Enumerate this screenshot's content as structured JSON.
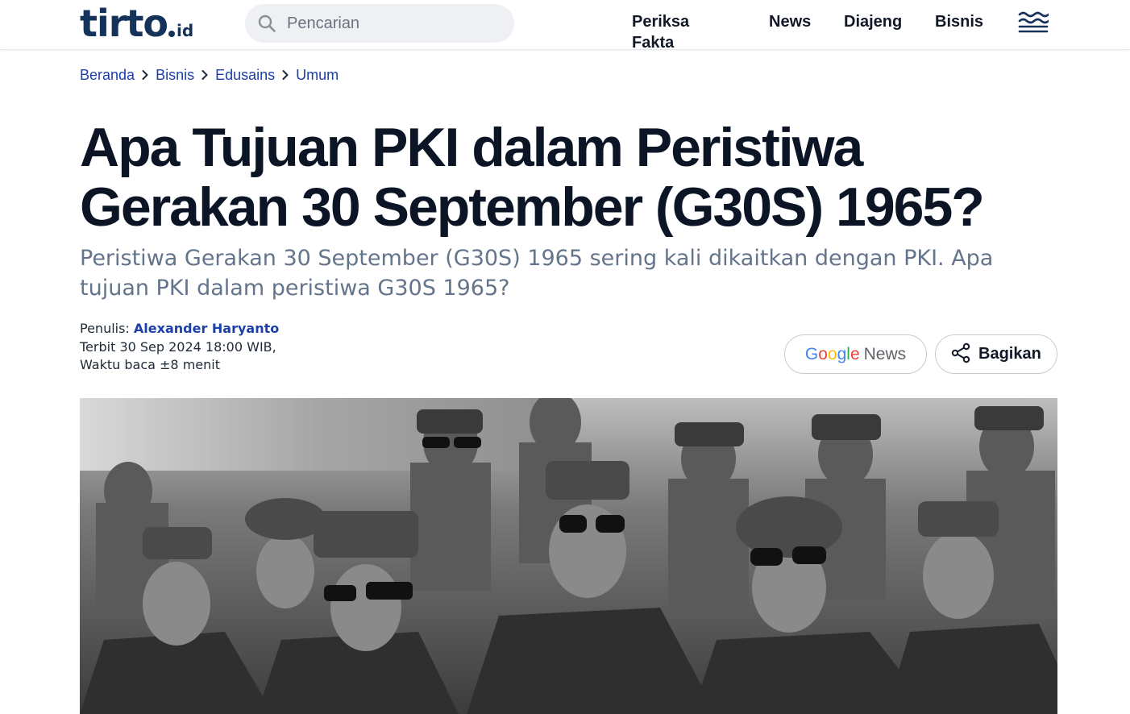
{
  "header": {
    "logo": {
      "main": "tirto",
      "sub": "id"
    },
    "search": {
      "placeholder": "Pencarian",
      "icon": "search-icon"
    },
    "nav": [
      {
        "label": "Periksa Fakta"
      },
      {
        "label": "News"
      },
      {
        "label": "Diajeng"
      },
      {
        "label": "Bisnis"
      }
    ],
    "menu_icon": "menu-wave-icon"
  },
  "breadcrumb": [
    {
      "label": "Beranda"
    },
    {
      "label": "Bisnis"
    },
    {
      "label": "Edusains"
    },
    {
      "label": "Umum"
    }
  ],
  "article": {
    "title_line1": "Apa Tujuan PKI dalam Peristiwa",
    "title_line2": "Gerakan 30 September (G30S) 1965?",
    "subtitle": "Peristiwa Gerakan 30 September (G30S) 1965 sering kali dikaitkan dengan PKI. Apa tujuan PKI dalam peristiwa G30S 1965?",
    "author_prefix": "Penulis:",
    "author_name": "Alexander Haryanto",
    "published": "Terbit 30 Sep 2024 18:00 WIB,",
    "reading_time": "Waktu baca ±8 menit"
  },
  "actions": {
    "google_news": {
      "google_letters": [
        "G",
        "o",
        "o",
        "g",
        "l",
        "e"
      ],
      "word": "News"
    },
    "share": {
      "label": "Bagikan",
      "icon": "share-icon"
    }
  },
  "hero_image": {
    "description_icon": "photo-soldiers"
  },
  "colors": {
    "brand": "#15335a",
    "link": "#1d3fa8",
    "title": "#0c1526",
    "subtitle": "#64748b"
  }
}
